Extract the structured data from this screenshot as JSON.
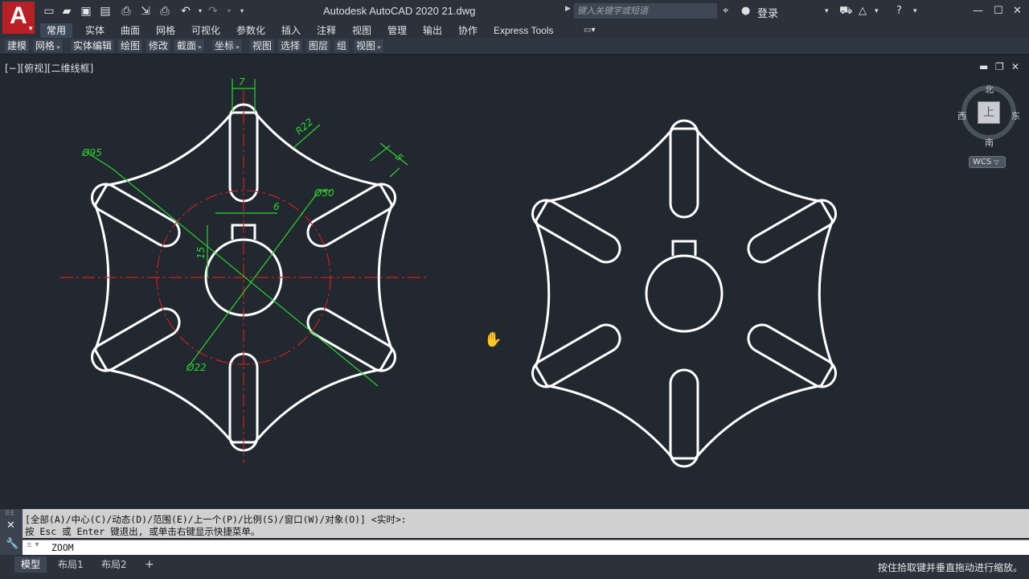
{
  "app": {
    "logo_letter": "A",
    "title": "Autodesk AutoCAD 2020    21.dwg",
    "search_placeholder": "键入关键字或短语",
    "login": "登录"
  },
  "ribbon_tabs": [
    "常用",
    "实体",
    "曲面",
    "网格",
    "可视化",
    "参数化",
    "插入",
    "注释",
    "视图",
    "管理",
    "输出",
    "协作",
    "Express Tools"
  ],
  "panels": [
    {
      "label": "建模",
      "dd": false
    },
    {
      "label": "网格",
      "dd": true
    },
    {
      "label": "实体编辑",
      "dd": false
    },
    {
      "label": "绘图",
      "dd": false
    },
    {
      "label": "修改",
      "dd": false
    },
    {
      "label": "截面",
      "dd": true
    },
    {
      "label": "坐标",
      "dd": true
    },
    {
      "label": "视图",
      "dd": false
    },
    {
      "label": "选择",
      "dd": false
    },
    {
      "label": "图层",
      "dd": false
    },
    {
      "label": "组",
      "dd": false
    },
    {
      "label": "视图",
      "dd": true
    }
  ],
  "viewport": {
    "label": "[−][俯视][二维线框]"
  },
  "viewcube": {
    "north": "北",
    "south": "南",
    "east": "东",
    "west": "西",
    "top": "上",
    "wcs": "WCS"
  },
  "dimensions": {
    "width_7": "7",
    "r22": "R22",
    "dim_5_right": "5",
    "d95": "Ø95",
    "d50": "Ø50",
    "width_6": "6",
    "keyway_15": "15",
    "d22": "Ø22"
  },
  "command": {
    "line1": "[全部(A)/中心(C)/动态(D)/范围(E)/上一个(P)/比例(S)/窗口(W)/对象(O)] <实时>:",
    "line2": "按 Esc 或 Enter 键退出, 或单击右键显示快捷菜单。",
    "current": "ZOOM"
  },
  "layout_tabs": [
    "模型",
    "布局1",
    "布局2"
  ],
  "status_hint": "按住拾取键并垂直拖动进行缩放。",
  "colors": {
    "background": "#212830",
    "dimension": "#2ed12e",
    "centerline": "#d21d1d",
    "geometry": "#ffffff"
  }
}
